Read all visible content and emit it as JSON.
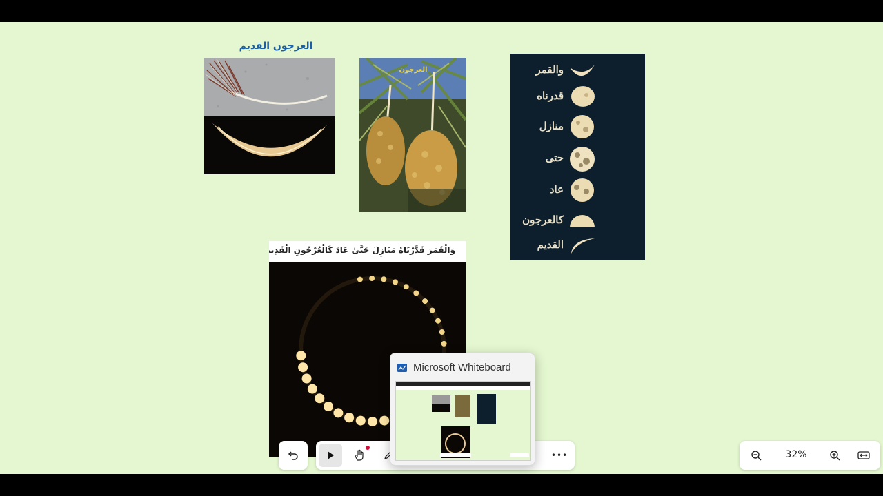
{
  "app": {
    "name": "Microsoft Whiteboard"
  },
  "board": {
    "title": "العرجون القديم",
    "eclipse_caption": "وَالْقَمَرَ قَدَّرْنَاهُ مَنَازِلَ حَتَّىٰ عَادَ كَالْعُرْجُونِ الْقَدِيمِ 🖤",
    "palm_label": "العرجون",
    "phases": [
      "والقمر",
      "قدرناه",
      "منازل",
      "حتى",
      "عاد",
      "كالعرجون",
      "القديم"
    ]
  },
  "toolbar": {
    "undo_icon": "undo-icon",
    "select_icon": "pointer-icon",
    "pan_icon": "hand-icon",
    "pen_icon": "pen-icon",
    "more_label": "•••"
  },
  "zoom": {
    "level": "32%"
  },
  "taskbar_preview": {
    "title": "Microsoft Whiteboard"
  },
  "colors": {
    "canvas": "#e4f7d0",
    "title": "#1a5fa8",
    "phase_bg": "#0d1f2d",
    "accent_dot": "#d0103a"
  }
}
